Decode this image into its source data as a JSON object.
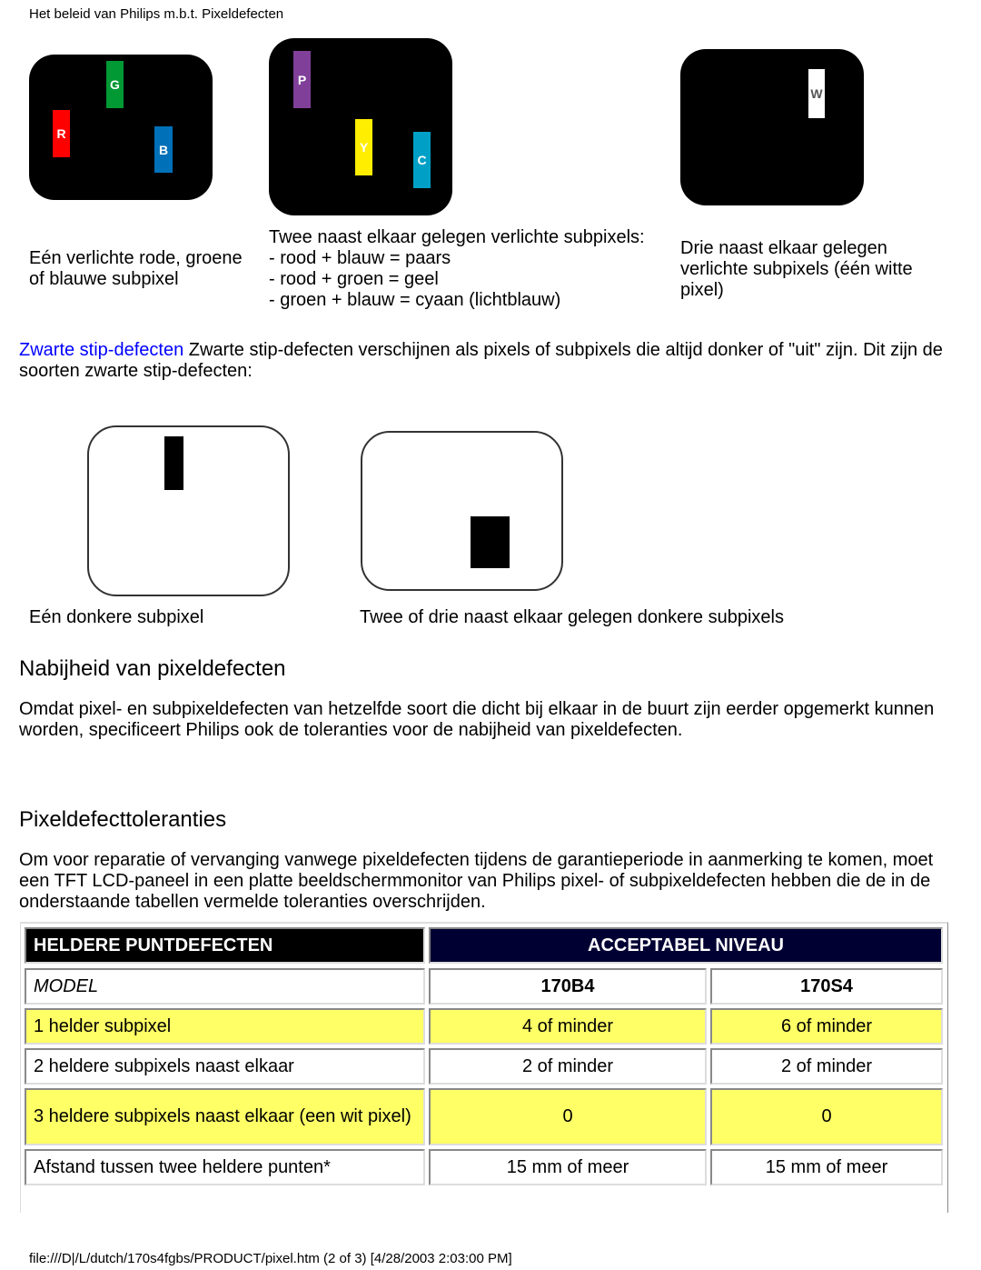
{
  "header": "Het beleid van Philips m.b.t. Pixeldefecten",
  "bright": {
    "img1": {
      "subpixels": [
        {
          "label": "R",
          "color": "#ff0000"
        },
        {
          "label": "G",
          "color": "#009933"
        },
        {
          "label": "B",
          "color": "#0070b8"
        }
      ]
    },
    "img2": {
      "subpixels": [
        {
          "label": "P",
          "color": "#80409a"
        },
        {
          "label": "Y",
          "color": "#ffee00"
        },
        {
          "label": "C",
          "color": "#00a0c6"
        }
      ]
    },
    "img3": {
      "subpixels": [
        {
          "label": "W",
          "color": "#ffffff"
        }
      ]
    },
    "caption1": "Eén verlichte rode, groene of blauwe subpixel",
    "caption2": [
      "Twee naast elkaar gelegen verlichte subpixels:",
      "- rood + blauw = paars",
      "- rood + groen = geel",
      "- groen + blauw = cyaan (lichtblauw)"
    ],
    "caption3": "Drie naast elkaar gelegen verlichte subpixels (één witte pixel)"
  },
  "black": {
    "link": "Zwarte stip-defecten",
    "text": " Zwarte stip-defecten verschijnen als pixels of subpixels die altijd donker of \"uit\" zijn. Dit zijn de soorten zwarte stip-defecten:",
    "caption1": "Eén donkere subpixel",
    "caption2": "Twee of drie naast elkaar gelegen donkere subpixels"
  },
  "proximity": {
    "title": "Nabijheid van pixeldefecten",
    "text": "Omdat pixel- en subpixeldefecten van hetzelfde soort die dicht bij elkaar in de buurt zijn eerder opgemerkt kunnen worden, specificeert Philips ook de toleranties voor de nabijheid van pixeldefecten."
  },
  "tolerances": {
    "title": "Pixeldefecttoleranties",
    "text": "Om voor reparatie of vervanging vanwege pixeldefecten tijdens de garantieperiode in aanmerking te komen, moet een TFT LCD-paneel in een platte beeldschermmonitor van Philips pixel- of subpixeldefecten hebben die de in de onderstaande tabellen vermelde toleranties overschrijden."
  },
  "table": {
    "header_left": "HELDERE PUNTDEFECTEN",
    "header_right": "ACCEPTABEL NIVEAU",
    "model_label": "MODEL",
    "models": [
      "170B4",
      "170S4"
    ],
    "rows": [
      {
        "label": "1 helder subpixel",
        "values": [
          "4 of minder",
          "6 of minder"
        ]
      },
      {
        "label": "2 heldere subpixels naast elkaar",
        "values": [
          "2 of minder",
          "2 of minder"
        ]
      },
      {
        "label": "3 heldere subpixels naast elkaar (een wit pixel)",
        "values": [
          "0",
          "0"
        ]
      },
      {
        "label": "Afstand tussen twee heldere punten*",
        "values": [
          "15 mm of meer",
          "15 mm of meer"
        ]
      }
    ],
    "colors": {
      "header_left": "#000000",
      "header_right": "#000033",
      "highlight": "#ffff66"
    }
  },
  "footer": "file:///D|/L/dutch/170s4fgbs/PRODUCT/pixel.htm (2 of 3) [4/28/2003 2:03:00 PM]"
}
